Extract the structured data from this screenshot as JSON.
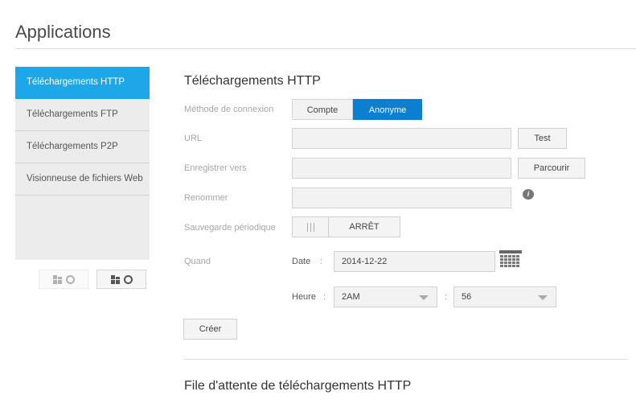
{
  "page": {
    "title": "Applications"
  },
  "sidebar": {
    "items": [
      {
        "label": "Téléchargements HTTP",
        "active": true
      },
      {
        "label": "Téléchargements FTP",
        "active": false
      },
      {
        "label": "Téléchargements P2P",
        "active": false
      },
      {
        "label": "Visionneuse de fichiers Web",
        "active": false
      }
    ]
  },
  "main": {
    "section_title": "Téléchargements HTTP",
    "connection": {
      "label": "Méthode de connexion",
      "options": [
        "Compte",
        "Anonyme"
      ],
      "selected": "Anonyme"
    },
    "url": {
      "label": "URL",
      "value": "",
      "button": "Test"
    },
    "save_to": {
      "label": "Enregistrer vers",
      "value": "",
      "button": "Parcourir"
    },
    "rename": {
      "label": "Renommer",
      "value": ""
    },
    "periodic": {
      "label": "Sauvegarde périodique",
      "state": "ARRÊT"
    },
    "when": {
      "label": "Quand",
      "date_label": "Date",
      "date_value": "2014-12-22",
      "time_label": "Heure",
      "hour_value": "2AM",
      "minute_value": "56",
      "colon": ":"
    },
    "create_button": "Créer",
    "queue_title": "File d'attente de téléchargements HTTP"
  },
  "colors": {
    "accent": "#1ea7e8",
    "selected_segment": "#0c7fd0"
  }
}
